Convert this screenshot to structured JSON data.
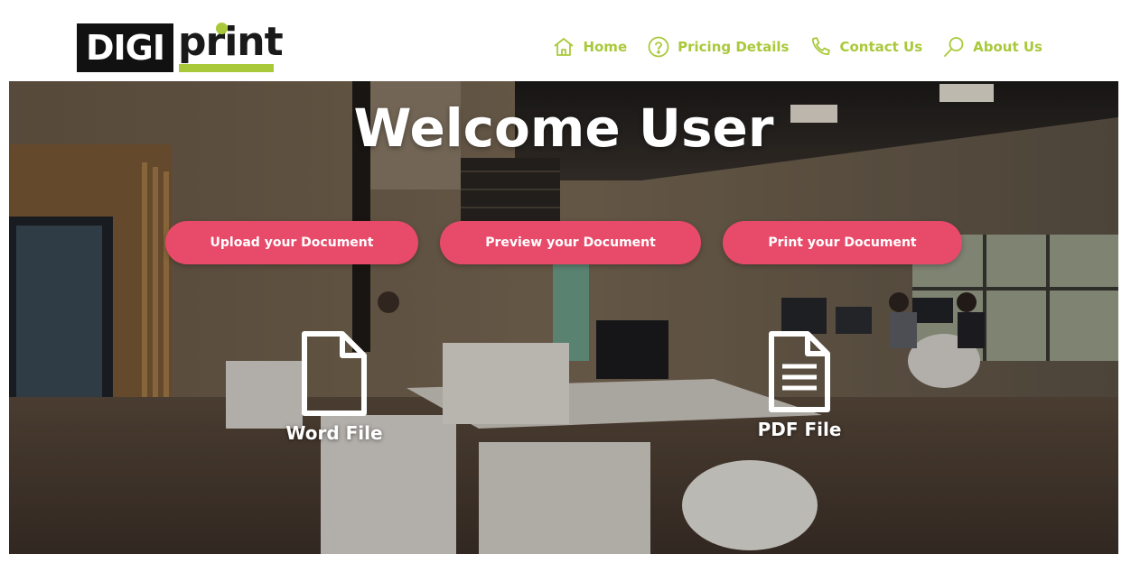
{
  "brand": {
    "logo_left": "DIGI",
    "logo_right": "print",
    "colors": {
      "accent": "#a9c93a",
      "button": "#e84a6a",
      "dark": "#111111"
    }
  },
  "nav": {
    "items": [
      {
        "label": "Home",
        "icon": "home-icon"
      },
      {
        "label": "Pricing Details",
        "icon": "question-circle-icon"
      },
      {
        "label": "Contact Us",
        "icon": "phone-icon"
      },
      {
        "label": "About Us",
        "icon": "search-icon"
      }
    ]
  },
  "hero": {
    "title": "Welcome User",
    "buttons": {
      "upload": "Upload your Document",
      "preview": "Preview your Document",
      "print": "Print your Document"
    },
    "files": {
      "word": {
        "label": "Word File",
        "icon": "blank-document-icon"
      },
      "pdf": {
        "label": "PDF File",
        "icon": "text-document-icon"
      }
    }
  }
}
